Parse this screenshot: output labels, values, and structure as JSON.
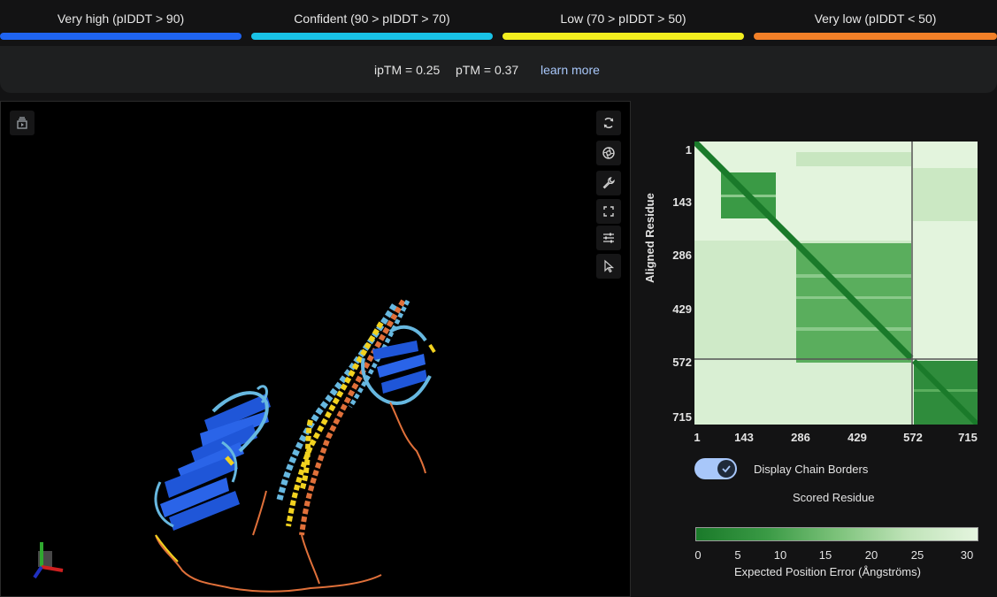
{
  "legend": [
    {
      "label": "Very high (pIDDT > 90)",
      "color": "#1f64f0"
    },
    {
      "label": "Confident (90 > pIDDT > 70)",
      "color": "#19c2e6"
    },
    {
      "label": "Low (70 > pIDDT > 50)",
      "color": "#f2ee1f"
    },
    {
      "label": "Very low (pIDDT < 50)",
      "color": "#f28028"
    }
  ],
  "metrics": {
    "iptm": "ipTM = 0.25",
    "ptm": "pTM = 0.37",
    "learn_more": "learn more"
  },
  "viewer": {
    "tools": [
      "rotate-icon",
      "camera-icon",
      "wrench-icon",
      "fullscreen-icon",
      "sliders-icon",
      "cursor-icon"
    ]
  },
  "pae": {
    "ticks": [
      "1",
      "143",
      "286",
      "429",
      "572",
      "715"
    ],
    "y_title": "Aligned Residue",
    "x_title": "Scored Residue",
    "toggle_label": "Display Chain Borders",
    "toggle_on": true,
    "colorbar_ticks": [
      "0",
      "5",
      "10",
      "15",
      "20",
      "25",
      "30"
    ],
    "colorbar_title": "Expected Position Error (Ångströms)"
  }
}
